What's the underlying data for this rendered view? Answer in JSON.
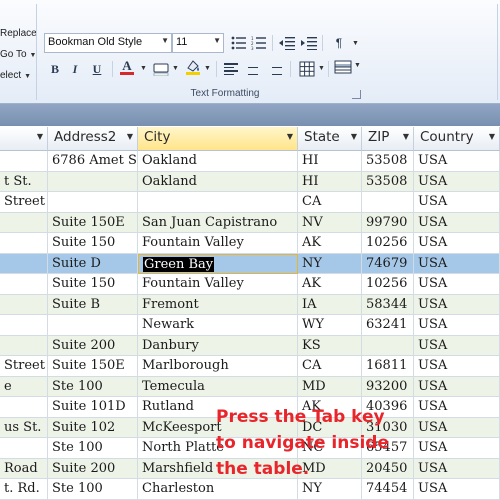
{
  "ribbon": {
    "left_commands": {
      "replace": "Replace",
      "goto": "Go To",
      "select": "elect"
    },
    "font_name": "Bookman Old Style",
    "font_size": "11",
    "group_label": "Text Formatting",
    "bold": "B",
    "italic": "I",
    "underline": "U",
    "font_color_glyph": "A",
    "font_color": "#d42a2a",
    "highlight_color": "#f2d000",
    "paragraph_glyph": "¶"
  },
  "table": {
    "columns": [
      {
        "label": "",
        "dropdown": true
      },
      {
        "label": "Address2",
        "dropdown": true
      },
      {
        "label": "City",
        "dropdown": true,
        "active": true
      },
      {
        "label": "State",
        "dropdown": true
      },
      {
        "label": "ZIP",
        "dropdown": true
      },
      {
        "label": "Country",
        "dropdown": true
      }
    ],
    "rows": [
      {
        "address": "",
        "address2": "6786 Amet S",
        "city": "Oakland",
        "state": "HI",
        "zip": "53508",
        "country": "USA"
      },
      {
        "address": "t St.",
        "address2": "",
        "city": "Oakland",
        "state": "HI",
        "zip": "53508",
        "country": "USA"
      },
      {
        "address": "Street",
        "address2": "",
        "city": "",
        "state": "CA",
        "zip": "",
        "country": "USA"
      },
      {
        "address": "",
        "address2": "Suite 150E",
        "city": "San Juan Capistrano",
        "state": "NV",
        "zip": "99790",
        "country": "USA"
      },
      {
        "address": "",
        "address2": "Suite 150",
        "city": "Fountain Valley",
        "state": "AK",
        "zip": "10256",
        "country": "USA"
      },
      {
        "address": "",
        "address2": "Suite D",
        "city": "Green Bay",
        "state": "NY",
        "zip": "74679",
        "country": "USA"
      },
      {
        "address": "",
        "address2": "Suite 150",
        "city": "Fountain Valley",
        "state": "AK",
        "zip": "10256",
        "country": "USA"
      },
      {
        "address": "",
        "address2": "Suite B",
        "city": "Fremont",
        "state": "IA",
        "zip": "58344",
        "country": "USA"
      },
      {
        "address": "",
        "address2": "",
        "city": "Newark",
        "state": "WY",
        "zip": "63241",
        "country": "USA"
      },
      {
        "address": "",
        "address2": "Suite 200",
        "city": "Danbury",
        "state": "KS",
        "zip": "",
        "country": "USA"
      },
      {
        "address": "Street",
        "address2": "Suite 150E",
        "city": "Marlborough",
        "state": "CA",
        "zip": "16811",
        "country": "USA"
      },
      {
        "address": "e",
        "address2": "Ste 100",
        "city": "Temecula",
        "state": "MD",
        "zip": "93200",
        "country": "USA"
      },
      {
        "address": "",
        "address2": "Suite 101D",
        "city": "Rutland",
        "state": "AK",
        "zip": "40396",
        "country": "USA"
      },
      {
        "address": "us St.",
        "address2": "Suite 102",
        "city": "McKeesport",
        "state": "DC",
        "zip": "31030",
        "country": "USA"
      },
      {
        "address": "",
        "address2": "Ste 100",
        "city": "North Platte",
        "state": "NC",
        "zip": "65457",
        "country": "USA"
      },
      {
        "address": "Road",
        "address2": "Suite 200",
        "city": "Marshfield",
        "state": "MD",
        "zip": "20450",
        "country": "USA"
      },
      {
        "address": "t. Rd.",
        "address2": "Ste 100",
        "city": "Charleston",
        "state": "NY",
        "zip": "74454",
        "country": "USA"
      }
    ]
  },
  "overlay": {
    "line1": "Press the Tab key",
    "line2": "to navigate inside",
    "line3": "the table."
  }
}
